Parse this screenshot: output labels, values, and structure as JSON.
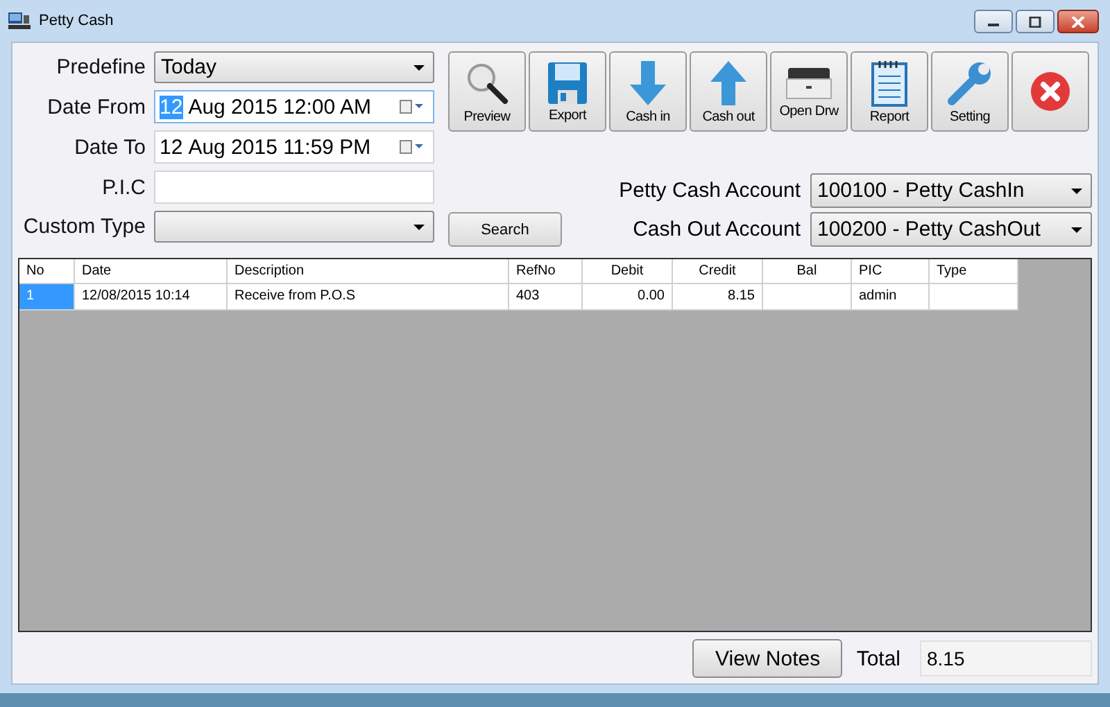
{
  "window": {
    "title": "Petty Cash"
  },
  "filters": {
    "predefine": {
      "label": "Predefine",
      "value": "Today"
    },
    "date_from": {
      "label": "Date From",
      "day": "12",
      "rest": "Aug 2015 12:00 AM",
      "day_selected": true
    },
    "date_to": {
      "label": "Date To",
      "day": "12",
      "rest": "Aug 2015 11:59 PM",
      "day_selected": false
    },
    "pic": {
      "label": "P.I.C"
    },
    "custom_type": {
      "label": "Custom Type"
    },
    "search_button": "Search"
  },
  "toolbar": [
    {
      "kind": "preview",
      "label": "Preview"
    },
    {
      "kind": "export",
      "label": "Export"
    },
    {
      "kind": "cash_in",
      "label": "Cash in"
    },
    {
      "kind": "cash_out",
      "label": "Cash out"
    },
    {
      "kind": "drawer",
      "label": "Open Drw"
    },
    {
      "kind": "report",
      "label": "Report"
    },
    {
      "kind": "setting",
      "label": "Setting"
    },
    {
      "kind": "close"
    }
  ],
  "accounts": [
    {
      "label": "Petty Cash Account",
      "value": "100100 - Petty CashIn"
    },
    {
      "label": "Cash Out Account",
      "value": "100200 - Petty CashOut"
    }
  ],
  "table": {
    "columns": [
      "No",
      "Date",
      "Description",
      "RefNo",
      "Debit",
      "Credit",
      "Bal",
      "PIC",
      "Type"
    ],
    "rows": [
      {
        "selected": true,
        "cells": [
          "1",
          "12/08/2015 10:14",
          "Receive from P.O.S",
          "403",
          "0.00",
          "8.15",
          "",
          "admin",
          ""
        ]
      }
    ]
  },
  "footer": {
    "view_notes": "View Notes",
    "total_label": "Total",
    "total": "8.15"
  }
}
